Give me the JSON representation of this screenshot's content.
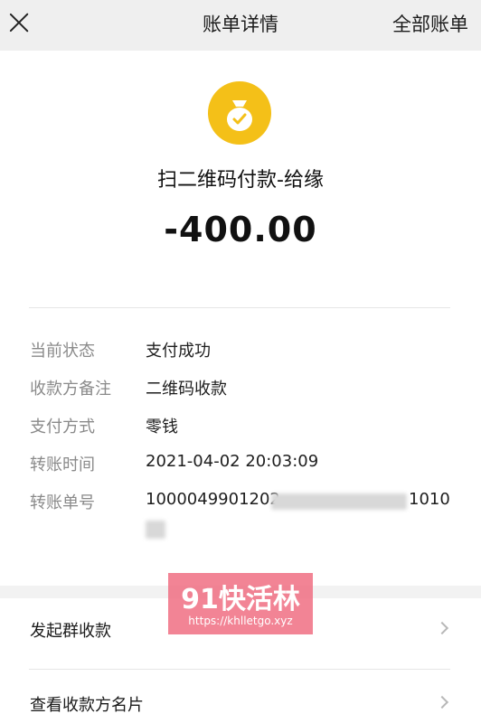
{
  "header": {
    "title": "账单详情",
    "right_label": "全部账单"
  },
  "transaction": {
    "merchant": "扫二维码付款-给缘",
    "amount": "-400.00"
  },
  "details": [
    {
      "label": "当前状态",
      "value": "支付成功"
    },
    {
      "label": "收款方备注",
      "value": "二维码收款"
    },
    {
      "label": "支付方式",
      "value": "零钱"
    },
    {
      "label": "转账时间",
      "value": "2021-04-02 20:03:09"
    },
    {
      "label": "转账单号",
      "value": "1000049901202"
    }
  ],
  "transfer_number_tail": "1010",
  "menu": [
    {
      "label": "发起群收款"
    },
    {
      "label": "查看收款方名片"
    }
  ],
  "watermark": {
    "title": "91快活林",
    "url": "https://khlletgo.xyz"
  },
  "colors": {
    "badge": "#f4c018",
    "header_bg": "#efefef",
    "label_gray": "#8a8a8a"
  },
  "icons": [
    "close-icon",
    "money-bag-check-icon",
    "chevron-right-icon"
  ]
}
